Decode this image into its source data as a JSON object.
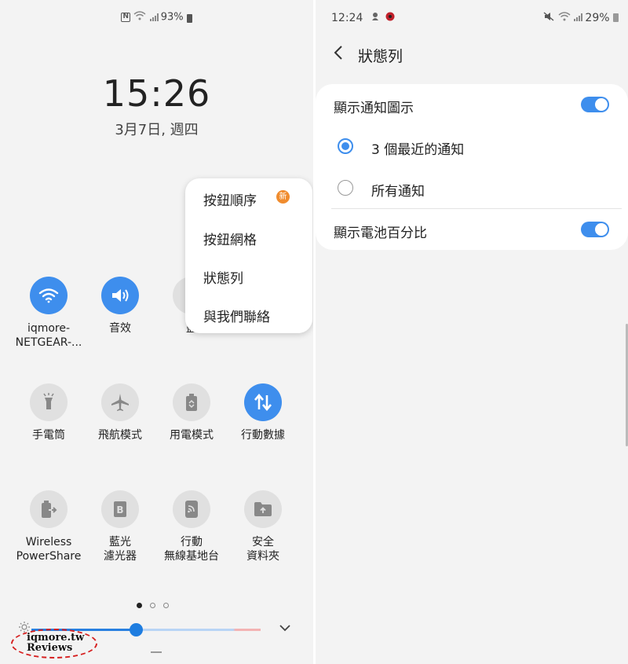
{
  "left": {
    "status": {
      "battery": "93%"
    },
    "clock": {
      "time": "15:26",
      "date": "3月7日, 週四"
    },
    "menu": {
      "items": [
        {
          "label": "按鈕順序",
          "badge": "新"
        },
        {
          "label": "按鈕網格"
        },
        {
          "label": "狀態列"
        },
        {
          "label": "與我們聯絡"
        }
      ]
    },
    "tiles": [
      {
        "label": "iqmore-\nNETGEAR-...",
        "icon": "wifi-icon",
        "on": true
      },
      {
        "label": "音效",
        "icon": "sound-icon",
        "on": true
      },
      {
        "label": "藍",
        "icon": "bluetooth-icon",
        "on": false
      },
      {
        "label": "手電筒",
        "icon": "flashlight-icon",
        "on": false
      },
      {
        "label": "飛航模式",
        "icon": "airplane-icon",
        "on": false
      },
      {
        "label": "用電模式",
        "icon": "battery-mode-icon",
        "on": false
      },
      {
        "label": "行動數據",
        "icon": "mobile-data-icon",
        "on": true
      },
      {
        "label": "Wireless\nPowerShare",
        "icon": "wireless-powershare-icon",
        "on": false
      },
      {
        "label": "藍光\n濾光器",
        "icon": "blue-light-filter-icon",
        "on": false
      },
      {
        "label": "行動\n無線基地台",
        "icon": "hotspot-icon",
        "on": false
      },
      {
        "label": "安全\n資料夾",
        "icon": "secure-folder-icon",
        "on": false
      }
    ],
    "pager": {
      "pages": 3,
      "active": 1
    },
    "brightness": {
      "level": 0.45
    },
    "watermark": {
      "line1": "iqmore.tw",
      "line2": "Reviews"
    }
  },
  "right": {
    "status": {
      "time": "12:24",
      "battery": "29%"
    },
    "header": {
      "title": "狀態列"
    },
    "settings": {
      "show_notification_icons": {
        "label": "顯示通知圖示",
        "on": true
      },
      "option_recent": {
        "label": "3 個最近的通知",
        "checked": true
      },
      "option_all": {
        "label": "所有通知",
        "checked": false
      },
      "show_battery_percent": {
        "label": "顯示電池百分比",
        "on": true
      }
    }
  },
  "colors": {
    "accent": "#3e8eed",
    "badge": "#f08c2e",
    "background": "#f3f3f3"
  }
}
